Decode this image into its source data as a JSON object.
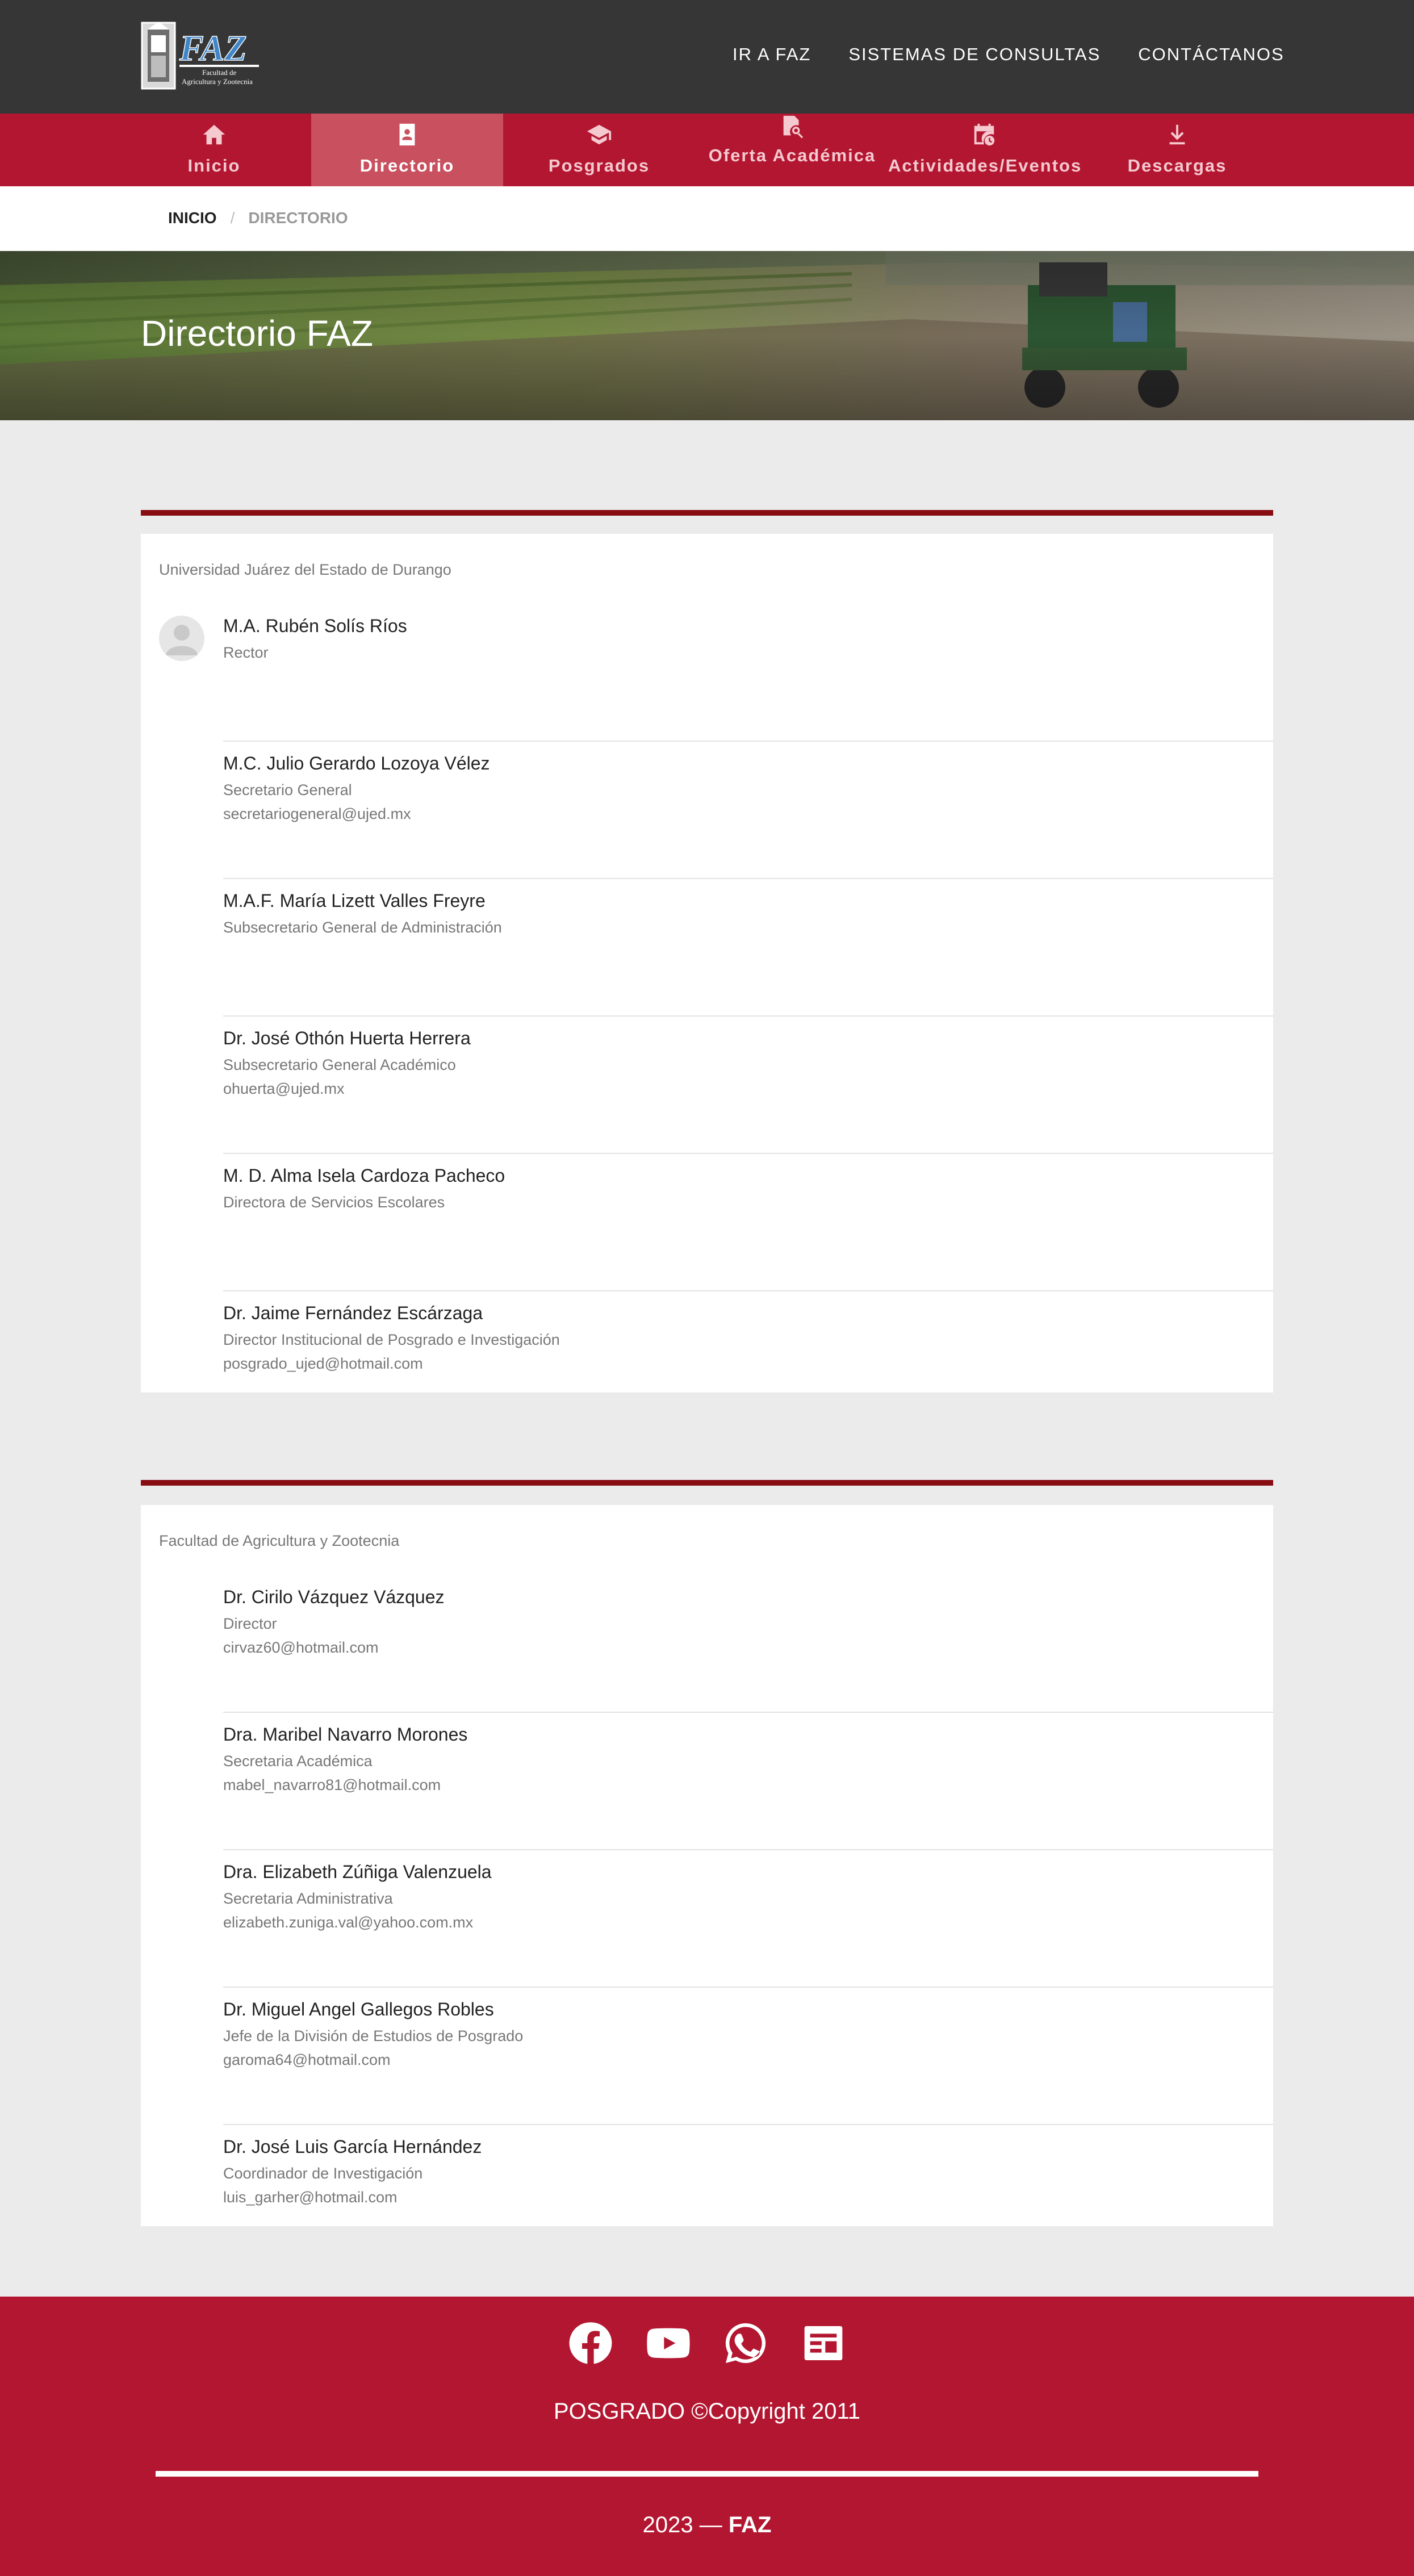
{
  "header": {
    "logo_text": "FAZ",
    "logo_subtitle": "Facultad de Agricultura y Zootecnia",
    "top_links": [
      "IR A FAZ",
      "SISTEMAS DE CONSULTAS",
      "CONTÁCTANOS"
    ]
  },
  "nav": {
    "items": [
      {
        "label": "Inicio",
        "icon": "home-icon"
      },
      {
        "label": "Directorio",
        "icon": "contact-book-icon",
        "active": true
      },
      {
        "label": "Posgrados",
        "icon": "graduation-cap-icon"
      },
      {
        "label": "Oferta Académica",
        "icon": "file-search-icon"
      },
      {
        "label": "Actividades/Eventos",
        "icon": "calendar-clock-icon"
      },
      {
        "label": "Descargas",
        "icon": "download-icon"
      }
    ]
  },
  "breadcrumb": {
    "home": "INICIO",
    "separator": "/",
    "current": "DIRECTORIO"
  },
  "hero": {
    "title": "Directorio FAZ"
  },
  "sections": [
    {
      "org": "Universidad Juárez del Estado de Durango",
      "people": [
        {
          "name": "M.A. Rubén Solís Ríos",
          "role": "Rector",
          "email": ""
        },
        {
          "name": "M.C. Julio Gerardo Lozoya Vélez",
          "role": "Secretario General",
          "email": "secretariogeneral@ujed.mx"
        },
        {
          "name": "M.A.F. María Lizett Valles Freyre",
          "role": "Subsecretario General de Administración",
          "email": ""
        },
        {
          "name": "Dr. José Othón Huerta Herrera",
          "role": "Subsecretario General Académico",
          "email": "ohuerta@ujed.mx"
        },
        {
          "name": "M. D. Alma Isela Cardoza Pacheco",
          "role": "Directora de Servicios Escolares",
          "email": ""
        },
        {
          "name": "Dr. Jaime Fernández Escárzaga",
          "role": "Director Institucional de Posgrado e Investigación",
          "email": "posgrado_ujed@hotmail.com"
        }
      ]
    },
    {
      "org": "Facultad de Agricultura y Zootecnia",
      "people": [
        {
          "name": "Dr. Cirilo Vázquez Vázquez",
          "role": "Director",
          "email": "cirvaz60@hotmail.com"
        },
        {
          "name": "Dra. Maribel Navarro Morones",
          "role": "Secretaria Académica",
          "email": "mabel_navarro81@hotmail.com"
        },
        {
          "name": "Dra. Elizabeth Zúñiga Valenzuela",
          "role": "Secretaria Administrativa",
          "email": "elizabeth.zuniga.val@yahoo.com.mx"
        },
        {
          "name": "Dr. Miguel Angel Gallegos Robles",
          "role": "Jefe de la División de Estudios de Posgrado",
          "email": "garoma64@hotmail.com"
        },
        {
          "name": "Dr. José Luis García Hernández",
          "role": "Coordinador de Investigación",
          "email": "luis_garher@hotmail.com"
        }
      ]
    }
  ],
  "footer": {
    "social": [
      "facebook-icon",
      "youtube-icon",
      "whatsapp-icon",
      "news-icon"
    ],
    "copyright": "POSGRADO ©Copyright 2011",
    "year": "2023 —",
    "brand": "FAZ"
  },
  "colors": {
    "topbar": "#363636",
    "nav_red": "#b31630",
    "nav_active": "#c9505f",
    "rule": "#870d12",
    "background": "#ecebec"
  }
}
